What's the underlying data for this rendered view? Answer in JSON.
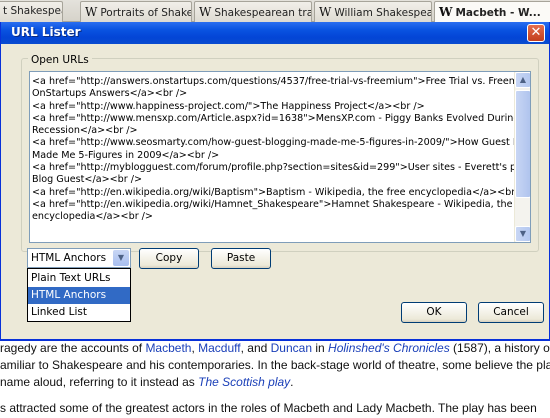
{
  "tabs": [
    {
      "label": "t Shakespea...",
      "icon": "wikipedia-w-icon"
    },
    {
      "label": "Portraits of Shakes...",
      "icon": "wikipedia-w-icon"
    },
    {
      "label": "Shakespearean tra...",
      "icon": "wikipedia-w-icon"
    },
    {
      "label": "William Shakespear...",
      "icon": "wikipedia-w-icon"
    },
    {
      "label": "Macbeth - W...",
      "icon": "wikipedia-w-icon"
    }
  ],
  "dialog": {
    "title": "URL Lister",
    "close_glyph": "✕",
    "group_label": "Open URLs",
    "url_lines": [
      "<a href=\"http://answers.onstartups.com/questions/4537/free-trial-vs-freemium\">Free Trial vs. Freemium -",
      "OnStartups Answers</a><br />",
      "<a href=\"http://www.happiness-project.com/\">The Happiness Project</a><br />",
      "<a href=\"http://www.mensxp.com/Article.aspx?id=1638\">MensXP.com - Piggy Banks Evolved During",
      "Recession</a><br />",
      "<a href=\"http://www.seosmarty.com/how-guest-blogging-made-me-5-figures-in-2009/\">How Guest Blogging",
      "Made Me 5-Figures in 2009</a><br />",
      "<a href=\"http://myblogguest.com/forum/profile.php?section=sites&id=299\">User sites - Everett's profile - My",
      "Blog Guest</a><br />",
      "<a href=\"http://en.wikipedia.org/wiki/Baptism\">Baptism - Wikipedia, the free encyclopedia</a><br />",
      "<a href=\"http://en.wikipedia.org/wiki/Hamnet_Shakespeare\">Hamnet Shakespeare - Wikipedia, the free",
      "encyclopedia</a><br />"
    ],
    "format_select": {
      "value": "HTML Anchors",
      "options": [
        "Plain Text URLs",
        "HTML Anchors",
        "Linked List"
      ],
      "selected_index": 1
    },
    "copy_label": "Copy",
    "paste_label": "Paste",
    "ok_label": "OK",
    "cancel_label": "Cancel"
  },
  "article": {
    "side_fragments": [
      "A",
      "A",
      "a"
    ],
    "p1_line1": {
      "before": "ragedy are the accounts of ",
      "link1": "Macbeth",
      "sep1": ", ",
      "link2": "Macduff",
      "sep2": ", and ",
      "link3": "Duncan",
      "mid": " in ",
      "ilink": "Holinshed's Chronicles",
      "after": " (1587), a history of"
    },
    "p1_line2": "amiliar to Shakespeare and his contemporaries. In the back-stage world of theatre, some believe the play",
    "p1_line3": {
      "before": "name aloud, referring to it instead as ",
      "ilink": "The Scottish play",
      "after": "."
    },
    "p2_line1": "s attracted some of the greatest actors in the roles of Macbeth and Lady Macbeth. The play has been"
  },
  "colors": {
    "titlebar": "#0a53e1",
    "dialog_bg": "#ece9d8",
    "selection": "#316ac5",
    "link": "#1a3fb8"
  }
}
